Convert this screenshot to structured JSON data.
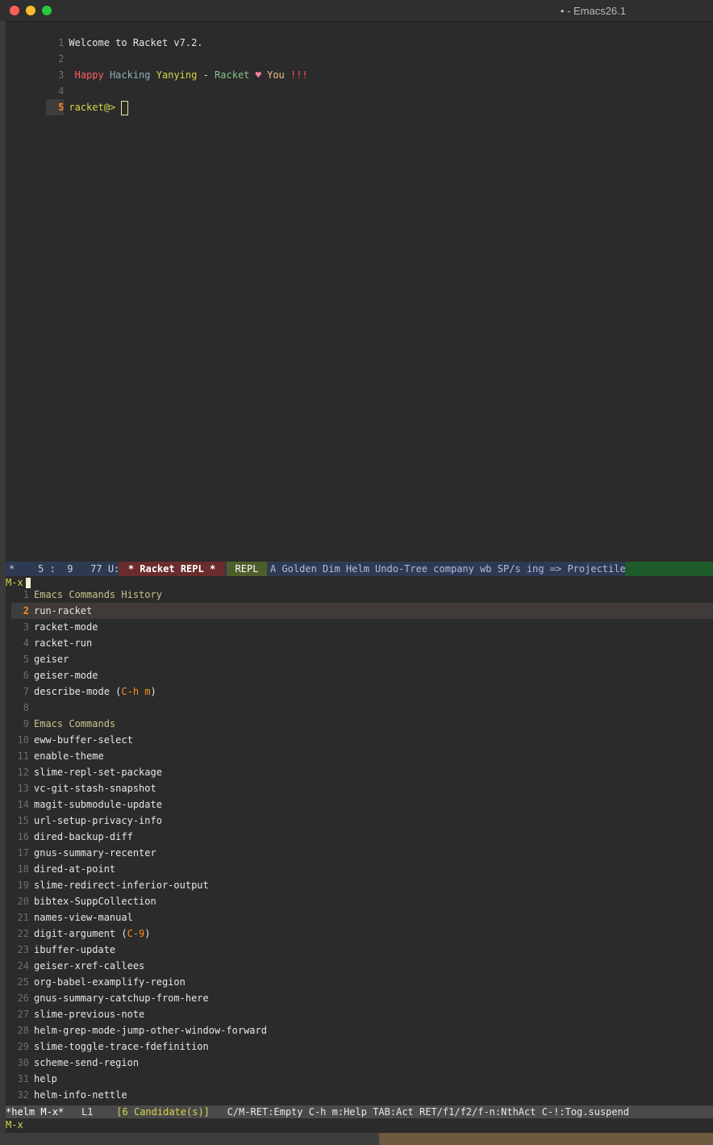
{
  "window": {
    "title": "• - Emacs26.1"
  },
  "repl": {
    "lines": [
      {
        "num": "1",
        "text": "Welcome to Racket v7.2."
      },
      {
        "num": "2",
        "text": ""
      },
      {
        "num": "3",
        "happy": "Happy",
        "hacking": "Hacking",
        "yanying": "Yanying",
        "dash": "-",
        "racket": "Racket",
        "heart": "♥",
        "you": "You",
        "bang": "!!!"
      },
      {
        "num": "4",
        "text": ""
      },
      {
        "num": "5",
        "prompt": "racket@>"
      }
    ]
  },
  "modeline": {
    "left": "*    5 :  9   77 U:",
    "buffer": "* Racket REPL *",
    "mode": "REPL",
    "minor_modes": "A Golden Dim Helm Undo-Tree company wb SP/s ing => Projectile"
  },
  "minibuffer": {
    "prompt": "M-x"
  },
  "helm": {
    "rows": [
      {
        "num": "1",
        "label": "Emacs Commands History",
        "kind": "header"
      },
      {
        "num": "2",
        "label": "run-racket",
        "kind": "selected"
      },
      {
        "num": "3",
        "label": "racket-mode"
      },
      {
        "num": "4",
        "label": "racket-run"
      },
      {
        "num": "5",
        "label": "geiser"
      },
      {
        "num": "6",
        "label": "geiser-mode"
      },
      {
        "num": "7",
        "label": "describe-mode",
        "key": "C-h m"
      },
      {
        "num": "8",
        "label": ""
      },
      {
        "num": "9",
        "label": "Emacs Commands",
        "kind": "header"
      },
      {
        "num": "10",
        "label": "eww-buffer-select"
      },
      {
        "num": "11",
        "label": "enable-theme"
      },
      {
        "num": "12",
        "label": "slime-repl-set-package"
      },
      {
        "num": "13",
        "label": "vc-git-stash-snapshot"
      },
      {
        "num": "14",
        "label": "magit-submodule-update"
      },
      {
        "num": "15",
        "label": "url-setup-privacy-info"
      },
      {
        "num": "16",
        "label": "dired-backup-diff"
      },
      {
        "num": "17",
        "label": "gnus-summary-recenter"
      },
      {
        "num": "18",
        "label": "dired-at-point"
      },
      {
        "num": "19",
        "label": "slime-redirect-inferior-output"
      },
      {
        "num": "20",
        "label": "bibtex-SuppCollection"
      },
      {
        "num": "21",
        "label": "names-view-manual"
      },
      {
        "num": "22",
        "label": "digit-argument",
        "key": "C-9"
      },
      {
        "num": "23",
        "label": "ibuffer-update"
      },
      {
        "num": "24",
        "label": "geiser-xref-callees"
      },
      {
        "num": "25",
        "label": "org-babel-examplify-region"
      },
      {
        "num": "26",
        "label": "gnus-summary-catchup-from-here"
      },
      {
        "num": "27",
        "label": "slime-previous-note"
      },
      {
        "num": "28",
        "label": "helm-grep-mode-jump-other-window-forward"
      },
      {
        "num": "29",
        "label": "slime-toggle-trace-fdefinition"
      },
      {
        "num": "30",
        "label": "scheme-send-region"
      },
      {
        "num": "31",
        "label": "help"
      },
      {
        "num": "32",
        "label": "helm-info-nettle"
      }
    ]
  },
  "helm_modeline": {
    "buffer": "*helm M-x*",
    "line": "L1",
    "candidates": "[6 Candidate(s)]",
    "help": "C/M-RET:Empty C-h m:Help TAB:Act RET/f1/f2/f-n:NthAct C-!:Tog.suspend"
  },
  "minibuffer_bottom": {
    "prompt": "M-x"
  },
  "colors": {
    "background": "#2b2b2b",
    "line_number_current": "#ff8c1a",
    "prompt": "#d7d74a",
    "modeline": "#2d3a52",
    "modeline_buffer": "#6a2c2c",
    "modeline_mode": "#4e5e2a"
  }
}
